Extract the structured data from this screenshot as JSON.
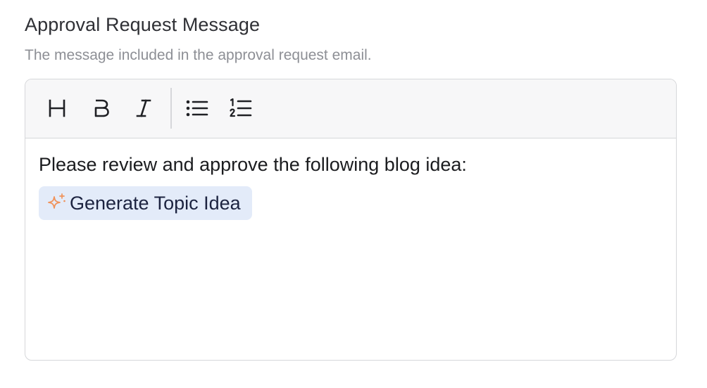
{
  "field": {
    "title": "Approval Request Message",
    "description": "The message included in the approval request email."
  },
  "toolbar": {
    "buttons": [
      {
        "icon": "heading-icon",
        "label": "H"
      },
      {
        "icon": "bold-icon",
        "label": "B"
      },
      {
        "icon": "italic-icon",
        "label": "I"
      },
      {
        "icon": "bullet-list-icon"
      },
      {
        "icon": "numbered-list-icon"
      }
    ]
  },
  "editor": {
    "paragraph": "Please review and approve the following blog idea:",
    "chip": {
      "label": "Generate Topic Idea",
      "icon": "sparkle-icon",
      "icon_color": "#f0925a",
      "background": "#e3ebf9"
    }
  }
}
